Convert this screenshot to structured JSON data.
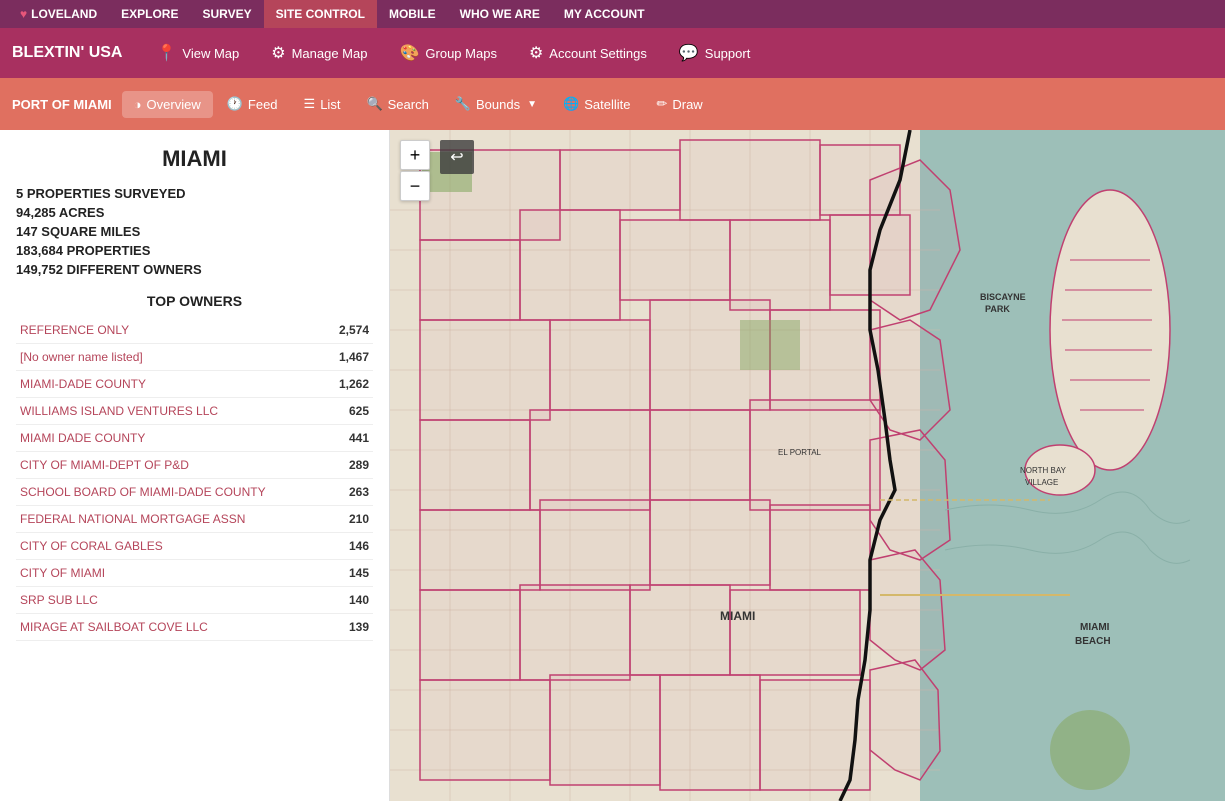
{
  "topNav": {
    "brand": "LOVELAND",
    "items": [
      {
        "label": "EXPLORE",
        "active": false
      },
      {
        "label": "SURVEY",
        "active": false
      },
      {
        "label": "SITE CONTROL",
        "active": true
      },
      {
        "label": "MOBILE",
        "active": false
      },
      {
        "label": "WHO WE ARE",
        "active": false
      },
      {
        "label": "MY ACCOUNT",
        "active": false
      }
    ]
  },
  "secondNav": {
    "brand": "BLEXTIN' USA",
    "items": [
      {
        "label": "View Map",
        "icon": "📍"
      },
      {
        "label": "Manage Map",
        "icon": "⚙"
      },
      {
        "label": "Group Maps",
        "icon": "🎨"
      },
      {
        "label": "Account Settings",
        "icon": "⚙"
      },
      {
        "label": "Support",
        "icon": "💬"
      }
    ]
  },
  "thirdNav": {
    "port": "PORT OF MIAMI",
    "items": [
      {
        "label": "Overview",
        "icon": "◑",
        "active": true
      },
      {
        "label": "Feed",
        "icon": "🕐"
      },
      {
        "label": "List",
        "icon": "☰"
      },
      {
        "label": "Search",
        "icon": "🔍"
      },
      {
        "label": "Bounds",
        "icon": "🔧",
        "dropdown": true
      },
      {
        "label": "Satellite",
        "icon": "🌐"
      },
      {
        "label": "Draw",
        "icon": "✏"
      }
    ]
  },
  "sidebar": {
    "cityName": "MIAMI",
    "stats": [
      "5 PROPERTIES SURVEYED",
      "94,285 ACRES",
      "147 SQUARE MILES",
      "183,684 PROPERTIES",
      "149,752 DIFFERENT OWNERS"
    ],
    "topOwnersTitle": "TOP OWNERS",
    "owners": [
      {
        "name": "REFERENCE ONLY",
        "count": "2,574"
      },
      {
        "name": "[No owner name listed]",
        "count": "1,467"
      },
      {
        "name": "MIAMI-DADE COUNTY",
        "count": "1,262"
      },
      {
        "name": "WILLIAMS ISLAND VENTURES LLC",
        "count": "625"
      },
      {
        "name": "MIAMI DADE COUNTY",
        "count": "441"
      },
      {
        "name": "CITY OF MIAMI-DEPT OF P&D",
        "count": "289"
      },
      {
        "name": "SCHOOL BOARD OF MIAMI-DADE COUNTY",
        "count": "263"
      },
      {
        "name": "FEDERAL NATIONAL MORTGAGE ASSN",
        "count": "210"
      },
      {
        "name": "CITY OF CORAL GABLES",
        "count": "146"
      },
      {
        "name": "CITY OF MIAMI",
        "count": "145"
      },
      {
        "name": "SRP SUB LLC",
        "count": "140"
      },
      {
        "name": "MIRAGE AT SAILBOAT COVE LLC",
        "count": "139"
      }
    ]
  },
  "mapControls": {
    "zoomIn": "+",
    "zoomOut": "−",
    "back": "↩"
  }
}
